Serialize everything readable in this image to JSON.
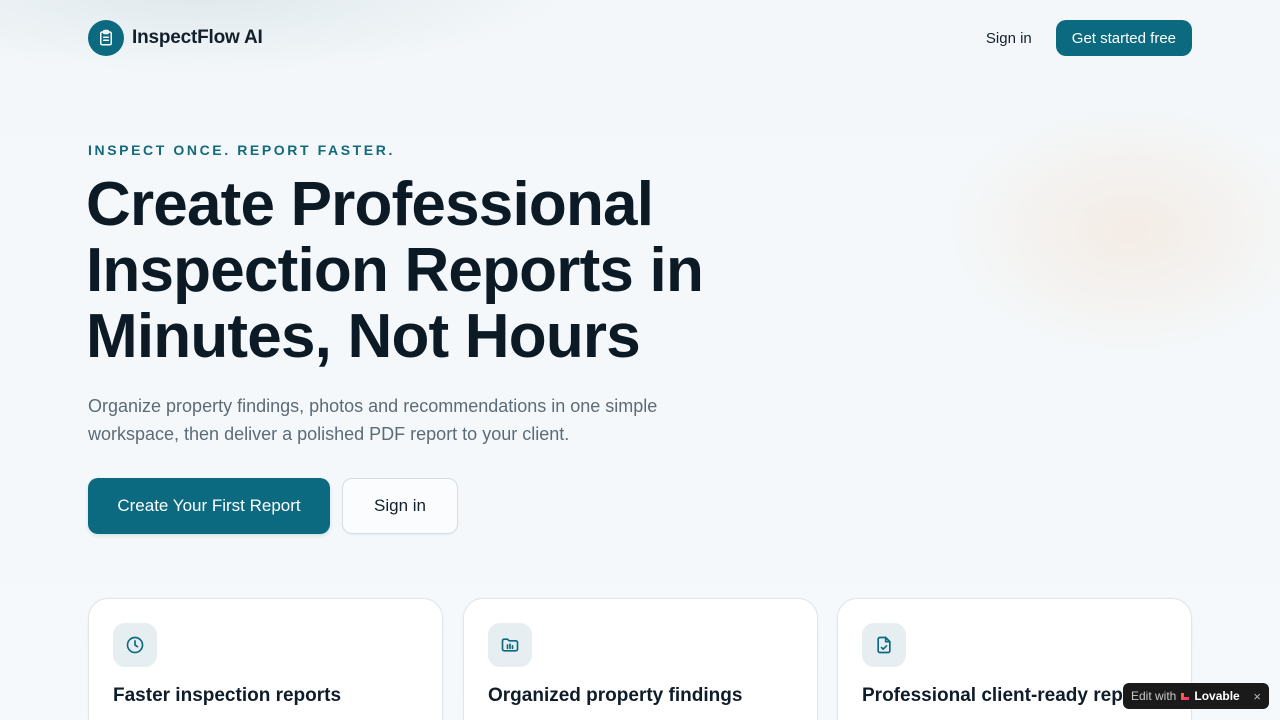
{
  "header": {
    "brand_name": "InspectFlow AI",
    "sign_in_label": "Sign in",
    "get_started_label": "Get started free"
  },
  "hero": {
    "eyebrow": "INSPECT ONCE. REPORT FASTER.",
    "title_line1": "Create Professional",
    "title_line2": "Inspection Reports in",
    "title_line3": "Minutes, Not Hours",
    "subtitle_line1": "Organize property findings, photos and recommendations in one simple",
    "subtitle_line2": "workspace, then deliver a polished PDF report to your client.",
    "primary_cta": "Create Your First Report",
    "secondary_cta": "Sign in"
  },
  "features": [
    {
      "icon": "clock-icon",
      "title": "Faster inspection reports"
    },
    {
      "icon": "folder-chart-icon",
      "title": "Organized property findings"
    },
    {
      "icon": "file-check-icon",
      "title": "Professional client-ready reports"
    }
  ],
  "badge": {
    "prefix": "Edit with",
    "brand": "Lovable",
    "close": "×"
  },
  "colors": {
    "accent": "#0b6a80",
    "eyebrow": "#136a7c",
    "text_dark": "#0c1a26",
    "text_muted": "#5d6b77"
  }
}
